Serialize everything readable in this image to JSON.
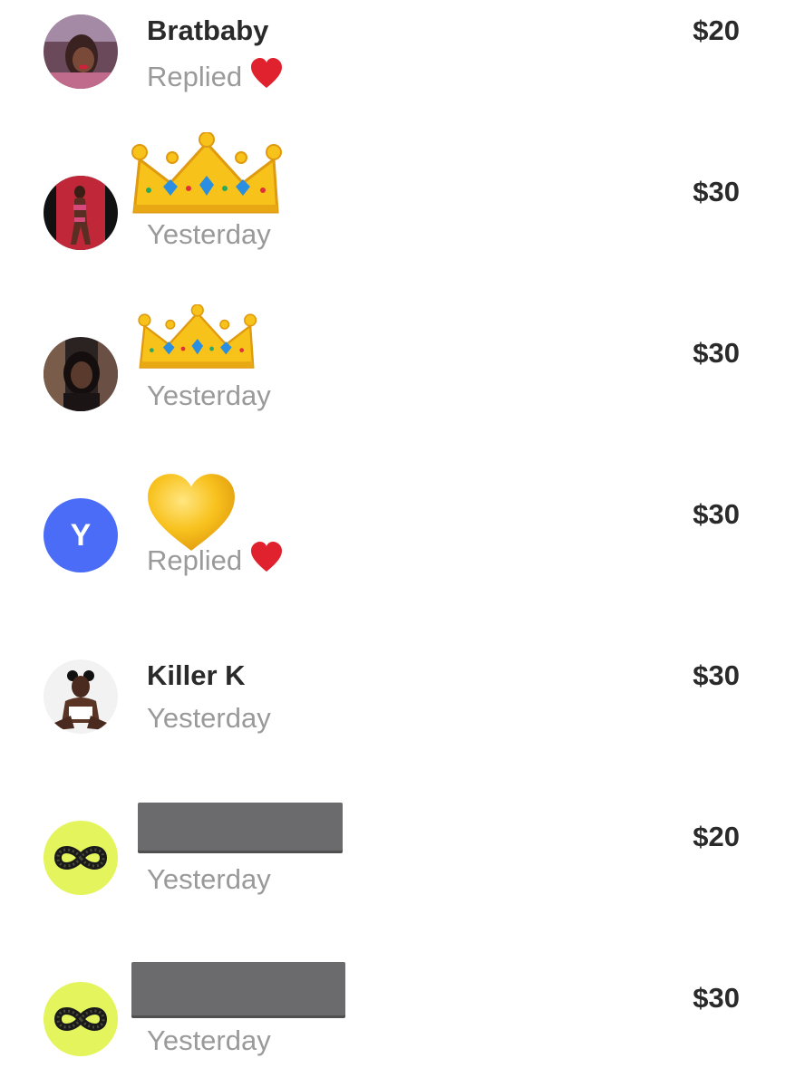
{
  "transactions": [
    {
      "name": "Bratbaby",
      "status": "Replied",
      "amount": "$20",
      "avatar": "photo",
      "status_icon": "red-heart-icon"
    },
    {
      "name": "",
      "name_icon": "crown-icon",
      "status": "Yesterday",
      "amount": "$30",
      "avatar": "photo"
    },
    {
      "name": "",
      "name_icon": "crown-icon",
      "status": "Yesterday",
      "amount": "$30",
      "avatar": "photo"
    },
    {
      "name": "",
      "name_icon": "yellow-heart-icon",
      "status": "Replied",
      "amount": "$30",
      "avatar_initial": "Y",
      "avatar_color": "#4a6cf7",
      "status_icon": "red-heart-icon"
    },
    {
      "name": "Killer K",
      "status": "Yesterday",
      "amount": "$30",
      "avatar": "photo"
    },
    {
      "name": "",
      "name_redacted": true,
      "status": "Yesterday",
      "amount": "$20",
      "avatar": "infinity-icon",
      "avatar_color": "#e3f45c"
    },
    {
      "name": "",
      "name_redacted": true,
      "status": "Yesterday",
      "amount": "$30",
      "avatar": "infinity-icon",
      "avatar_color": "#e3f45c"
    }
  ]
}
